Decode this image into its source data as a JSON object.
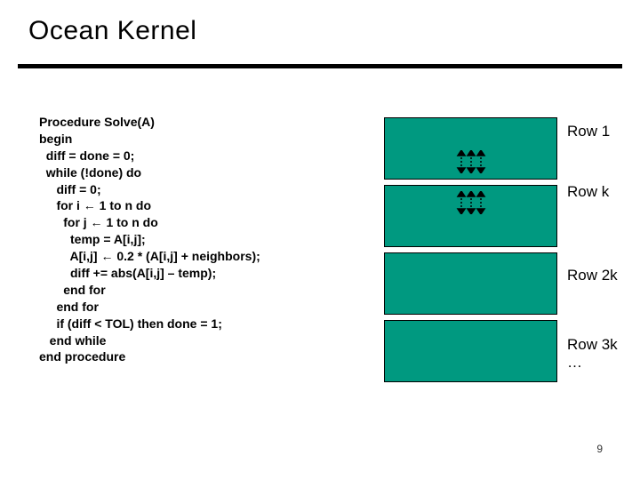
{
  "title": "Ocean Kernel",
  "code": {
    "l01": "Procedure Solve(A)",
    "l02": "begin",
    "l03": "  diff = done = 0;",
    "l04": "  while (!done) do",
    "l05": "     diff = 0;",
    "l06": "     for i ← 1 to n do",
    "l07": "       for j ← 1 to n do",
    "l08": "         temp = A[i,j];",
    "l09": "         A[i,j] ← 0.2 * (A[i,j] + neighbors);",
    "l10": "         diff += abs(A[i,j] – temp);",
    "l11": "       end for",
    "l12": "     end for",
    "l13": "     if (diff < TOL) then done = 1;",
    "l14": "   end while",
    "l15": "end procedure"
  },
  "rows": {
    "r1": "Row 1",
    "r2": "Row k",
    "r3": "Row 2k",
    "r4": "Row 3k",
    "r5": "…"
  },
  "page": "9"
}
